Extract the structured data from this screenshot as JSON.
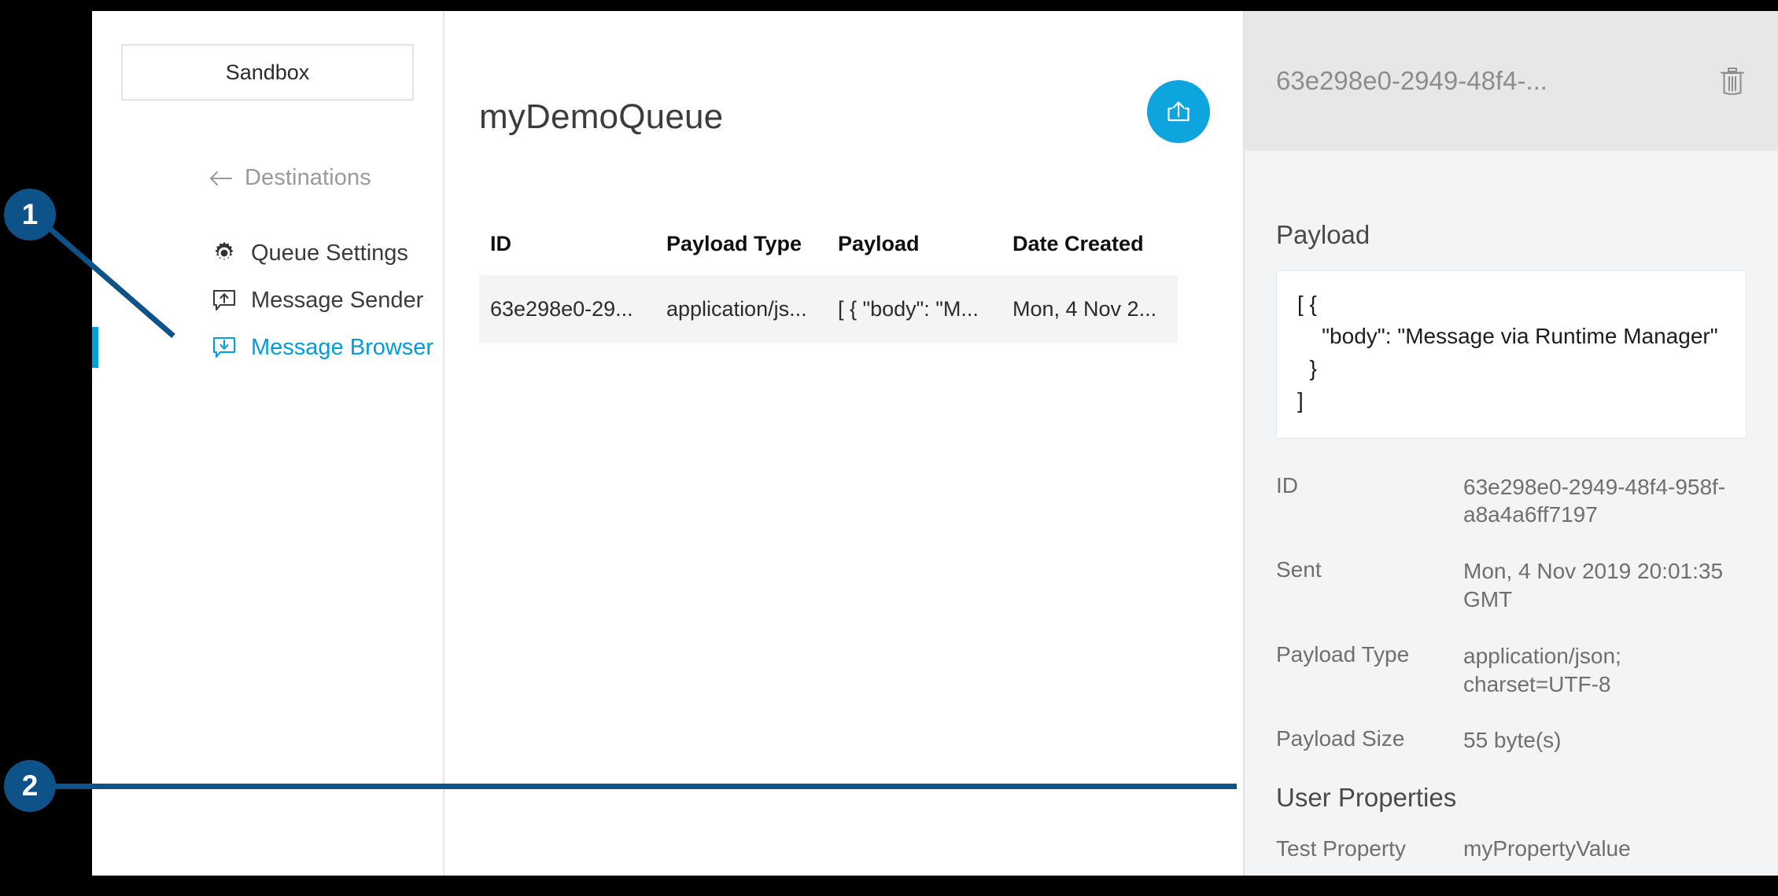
{
  "sidebar": {
    "env_button_label": "Sandbox",
    "back_link": {
      "label": "Destinations",
      "icon": "arrow-left-icon"
    },
    "items": [
      {
        "label": "Queue Settings",
        "icon": "gear-icon",
        "active": false
      },
      {
        "label": "Message Sender",
        "icon": "message-upload-icon",
        "active": false
      },
      {
        "label": "Message Browser",
        "icon": "message-download-icon",
        "active": true
      }
    ]
  },
  "main": {
    "title": "myDemoQueue",
    "fab": {
      "icon": "upload-share-icon",
      "color": "#0ea5de"
    },
    "table": {
      "columns": [
        "ID",
        "Payload Type",
        "Payload",
        "Date Created"
      ],
      "rows": [
        {
          "id": "63e298e0-29...",
          "payload_type": "application/js...",
          "payload": "[ { \"body\": \"M...",
          "date_created": "Mon, 4 Nov 2..."
        }
      ]
    }
  },
  "detail": {
    "header_title": "63e298e0-2949-48f4-...",
    "delete_icon": "trash-icon",
    "payload_section_title": "Payload",
    "payload_text": "[ {\n    \"body\": \"Message via Runtime Manager\"\n  }\n]",
    "metadata": [
      {
        "key": "ID",
        "value": "63e298e0-2949-48f4-958f-a8a4a6ff7197"
      },
      {
        "key": "Sent",
        "value": "Mon, 4 Nov 2019 20:01:35 GMT"
      },
      {
        "key": "Payload Type",
        "value": "application/json; charset=UTF-8"
      },
      {
        "key": "Payload Size",
        "value": "55 byte(s)"
      }
    ],
    "user_properties_title": "User Properties",
    "user_properties": [
      {
        "key": "Test Property",
        "value": "myPropertyValue"
      }
    ]
  },
  "annotations": {
    "color": "#0d5289",
    "badges": [
      {
        "number": "1"
      },
      {
        "number": "2"
      }
    ]
  }
}
